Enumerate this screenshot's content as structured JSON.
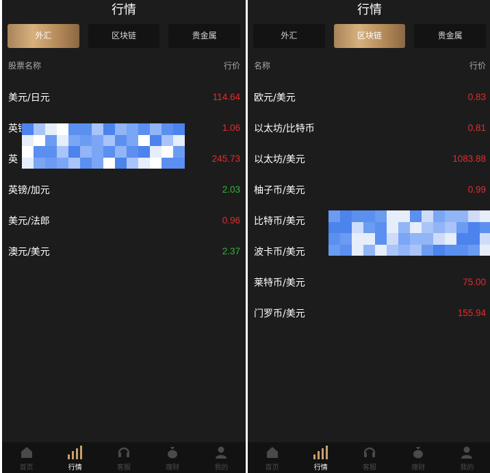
{
  "colors": {
    "background": "#1d1c1d",
    "accent_gold": "#c8a06a",
    "price_down": "#e02d2d",
    "price_up": "#2fb43c"
  },
  "left": {
    "title": "行情",
    "tabs": [
      {
        "label": "外汇",
        "active": true
      },
      {
        "label": "区块链",
        "active": false
      },
      {
        "label": "贵金属",
        "active": false
      }
    ],
    "header": {
      "name": "股票名称",
      "price": "行价"
    },
    "rows": [
      {
        "name": "美元/日元",
        "price": "114.64",
        "trend": "down"
      },
      {
        "name": "英镑",
        "price": "1.06",
        "trend": "down"
      },
      {
        "name": "英",
        "price": "245.73",
        "trend": "down"
      },
      {
        "name": "英镑/加元",
        "price": "2.03",
        "trend": "up"
      },
      {
        "name": "美元/法郎",
        "price": "0.96",
        "trend": "down"
      },
      {
        "name": "澳元/美元",
        "price": "2.37",
        "trend": "up"
      }
    ]
  },
  "right": {
    "title": "行情",
    "tabs": [
      {
        "label": "外汇",
        "active": false
      },
      {
        "label": "区块链",
        "active": true
      },
      {
        "label": "贵金属",
        "active": false
      }
    ],
    "header": {
      "name": "名称",
      "price": "行价"
    },
    "rows": [
      {
        "name": "欧元/美元",
        "price": "0.83",
        "trend": "down"
      },
      {
        "name": "以太坊/比特币",
        "price": "0.81",
        "trend": "down"
      },
      {
        "name": "以太坊/美元",
        "price": "1083.88",
        "trend": "down"
      },
      {
        "name": "柚子币/美元",
        "price": "0.99",
        "trend": "down"
      },
      {
        "name": "比特币/美元",
        "price": "",
        "trend": "down"
      },
      {
        "name": "波卡币/美元",
        "price": "",
        "trend": "down"
      },
      {
        "name": "莱特币/美元",
        "price": "75.00",
        "trend": "down"
      },
      {
        "name": "门罗币/美元",
        "price": "155.94",
        "trend": "down"
      }
    ]
  },
  "nav": [
    {
      "label": "首页",
      "icon": "home-icon",
      "active": false
    },
    {
      "label": "行情",
      "icon": "market-bars-icon",
      "active": true
    },
    {
      "label": "客服",
      "icon": "headset-icon",
      "active": false
    },
    {
      "label": "理财",
      "icon": "money-bag-icon",
      "active": false
    },
    {
      "label": "我的",
      "icon": "user-icon",
      "active": false
    }
  ]
}
